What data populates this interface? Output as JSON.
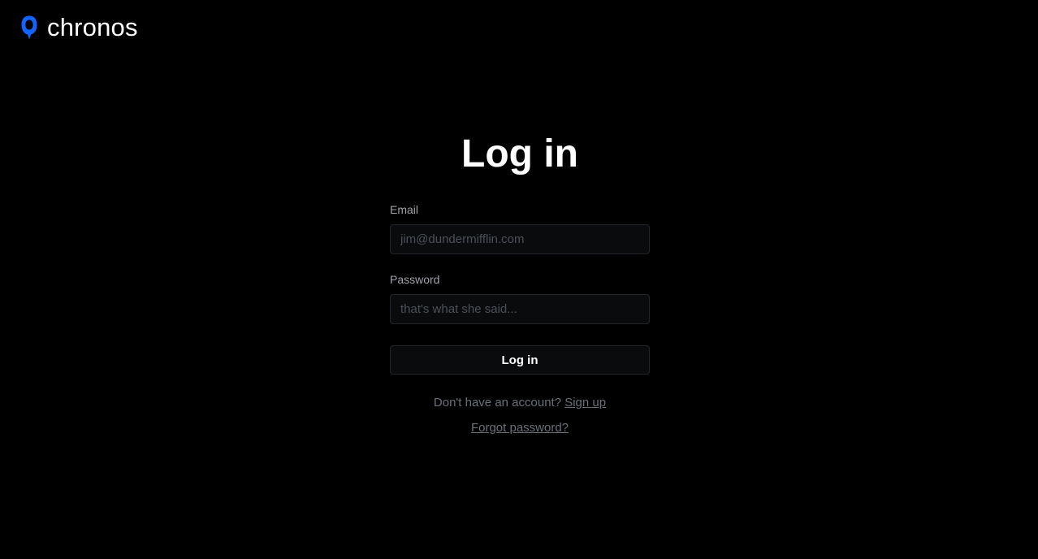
{
  "header": {
    "brand_name": "chronos",
    "logo_icon": "chronos-logo-icon",
    "logo_color": "#1463ff"
  },
  "login": {
    "title": "Log in",
    "email": {
      "label": "Email",
      "placeholder": "jim@dundermifflin.com",
      "value": ""
    },
    "password": {
      "label": "Password",
      "placeholder": "that's what she said...",
      "value": ""
    },
    "submit_label": "Log in",
    "signup_prompt": "Don't have an account?",
    "signup_link": "Sign up",
    "forgot_link": "Forgot password?"
  }
}
